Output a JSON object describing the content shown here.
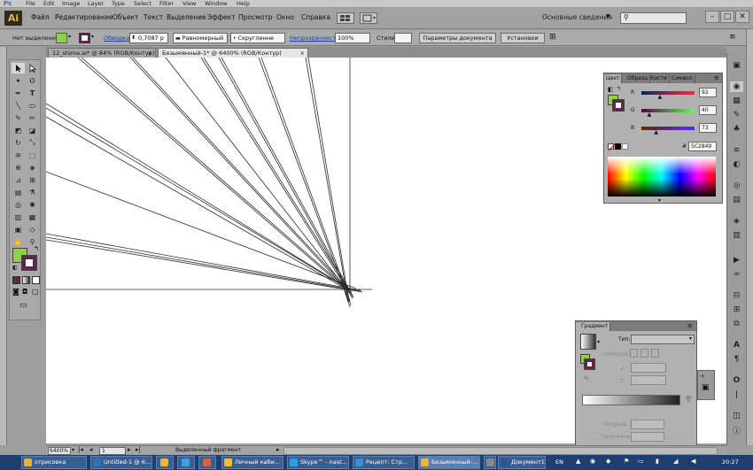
{
  "ps_menu": {
    "logo": "Ps",
    "items": [
      "File",
      "Edit",
      "Image",
      "Layer",
      "Type",
      "Select",
      "Filter",
      "View",
      "Window",
      "Help"
    ]
  },
  "ai_menu": {
    "logo": "Ai",
    "items": [
      "Файл",
      "Редактирование",
      "Объект",
      "Текст",
      "Выделение",
      "Эффект",
      "Просмотр",
      "Окно",
      "Справка"
    ],
    "workspace": "Основные сведения"
  },
  "control_bar": {
    "selection_label": "Нет выделения",
    "stroke_label": "Обводка:",
    "stroke_value": "0,7087 p",
    "profile_value": "Равномерный",
    "brush_value": "Скругленне",
    "opacity_label": "Непрозрачность:",
    "opacity_value": "100%",
    "styles_label": "Стили:",
    "doc_setup_button": "Параметры документа",
    "prefs_button": "Установки"
  },
  "tabs": [
    {
      "label": "12_shima.ai* @ 84% (RGB/Контур)",
      "active": false
    },
    {
      "label": "Безымянный-1* @ 6400% (RGB/Контур)",
      "active": true
    }
  ],
  "color_panel": {
    "tabs": [
      "Цвет",
      "Образц",
      "Кисти",
      "Символ"
    ],
    "channels": [
      {
        "label": "R",
        "value": "92",
        "fraction": 0.36
      },
      {
        "label": "G",
        "value": "40",
        "fraction": 0.16
      },
      {
        "label": "B",
        "value": "73",
        "fraction": 0.29
      }
    ],
    "hex_label": "#",
    "hex_value": "5C2849",
    "fill_color": "#8fd146",
    "stroke_color": "#5c2849"
  },
  "gradient_panel": {
    "tab": "Градиент",
    "type_label": "Тип:",
    "stroke_label": "Обводка:",
    "opacity_label": "Непрозр.:",
    "position_label": "Положение:"
  },
  "status_bar": {
    "zoom": "6400%",
    "page": "1",
    "mode": "Выделенный фрагмент"
  },
  "taskbar": {
    "items": [
      {
        "label": "отрисовка",
        "color": "#e5b33a"
      },
      {
        "label": "Untitled-1 @ 6...",
        "color": "#2f6fbf"
      },
      {
        "label": "",
        "color": "#e8b63a"
      },
      {
        "label": "",
        "color": "#3da0e0"
      },
      {
        "label": "",
        "color": "#e06030"
      },
      {
        "label": "Личный каби...",
        "color": "#f0c030"
      },
      {
        "label": "Skype™ - nast...",
        "color": "#2aa0e8"
      },
      {
        "label": "Рецепт: Стр...",
        "color": "#3a8fd0"
      },
      {
        "label": "Безымянный-...",
        "color": "#e8b63a"
      },
      {
        "label": "",
        "color": "#888888"
      },
      {
        "label": "Документ1 - ...",
        "color": "#2b5797"
      }
    ],
    "lang": "EN",
    "time": "20:27"
  }
}
